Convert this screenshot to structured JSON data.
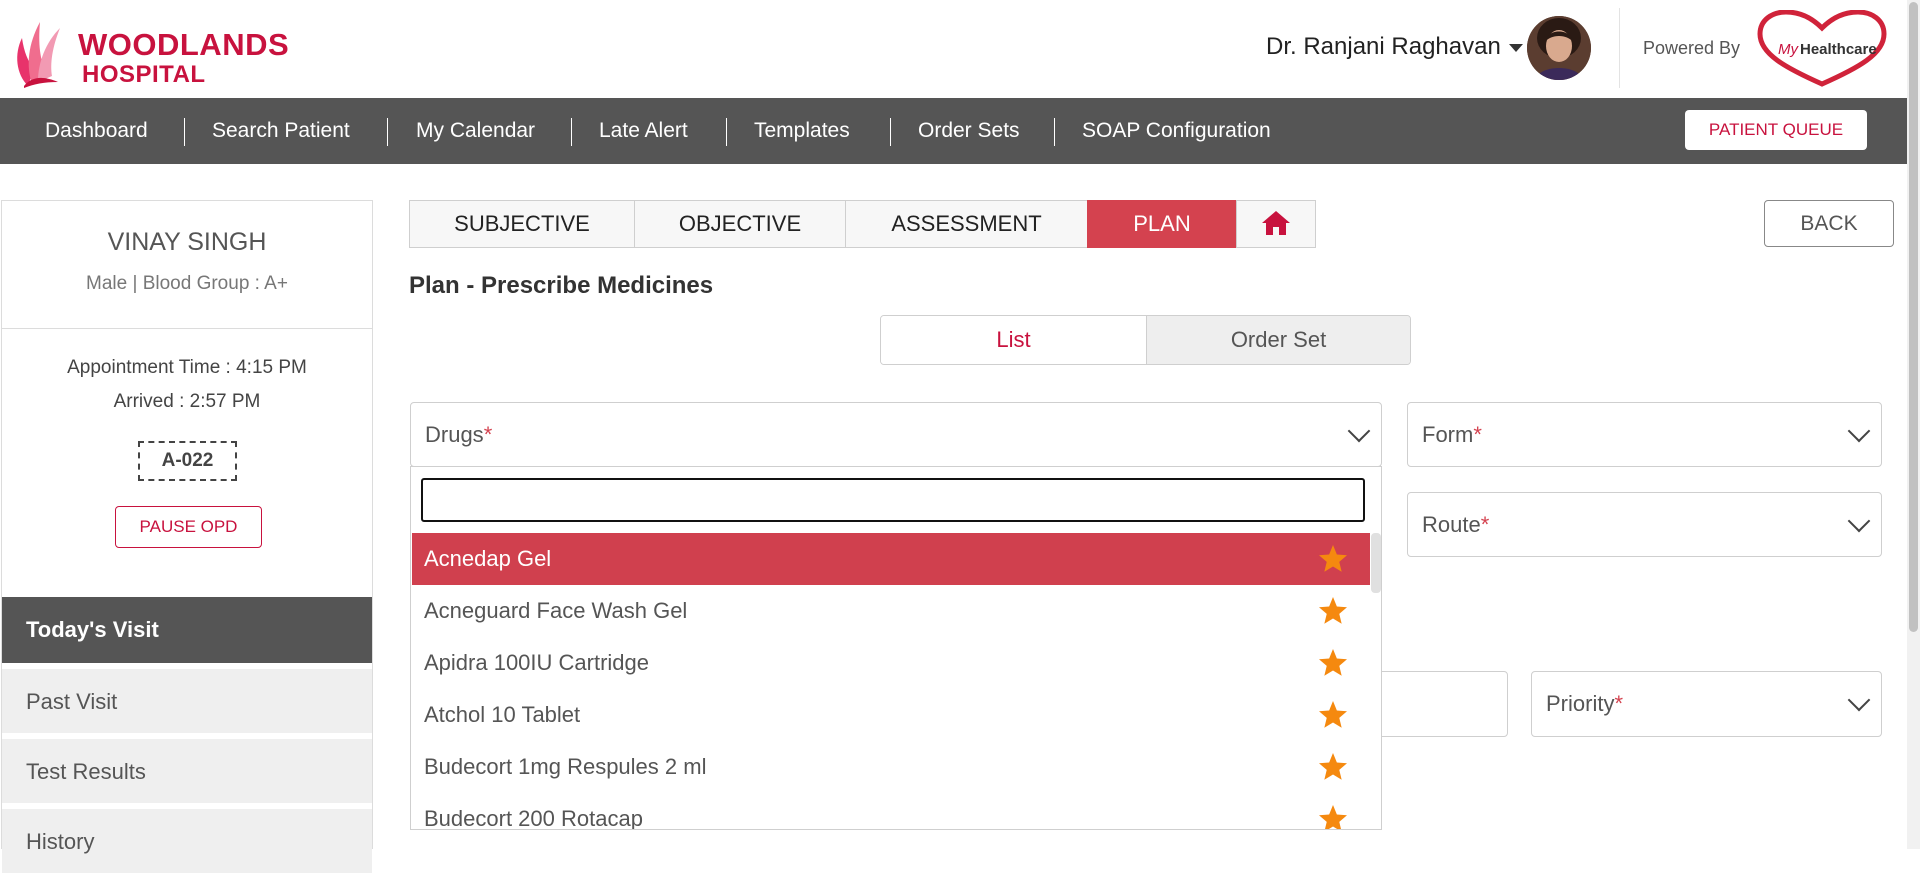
{
  "header": {
    "logo_line1": "WOODLANDS",
    "logo_line2": "HOSPITAL",
    "doctor_name": "Dr. Ranjani Raghavan",
    "powered_by": "Powered By",
    "partner_logo_text": "MyHealthcare"
  },
  "nav": {
    "items": [
      "Dashboard",
      "Search Patient",
      "My Calendar",
      "Late Alert",
      "Templates",
      "Order Sets",
      "SOAP Configuration"
    ],
    "patient_queue": "PATIENT QUEUE"
  },
  "patient": {
    "name": "VINAY SINGH",
    "info": "Male | Blood Group : A+",
    "appointment": "Appointment Time : 4:15 PM",
    "arrived": "Arrived : 2:57 PM",
    "token": "A-022",
    "pause_label": "PAUSE OPD"
  },
  "visit_menu": [
    "Today's Visit",
    "Past Visit",
    "Test Results",
    "History"
  ],
  "tabs": [
    "SUBJECTIVE",
    "OBJECTIVE",
    "ASSESSMENT",
    "PLAN"
  ],
  "active_tab": "PLAN",
  "back_label": "BACK",
  "section_title": "Plan - Prescribe Medicines",
  "toggle": {
    "list": "List",
    "order_set": "Order Set"
  },
  "fields": {
    "drugs": "Drugs",
    "form": "Form",
    "route": "Route",
    "priority": "Priority",
    "required_mark": "*"
  },
  "dropdown": {
    "search_value": "",
    "items": [
      "Acnedap Gel",
      "Acneguard Face Wash Gel",
      "Apidra 100IU Cartridge",
      "Atchol 10 Tablet",
      "Budecort 1mg Respules 2 ml",
      "Budecort 200 Rotacap"
    ],
    "selected_index": 0
  },
  "colors": {
    "brand": "#c8123e",
    "active_tab": "#d4424f",
    "nav_bg": "#555555",
    "star": "#f5890f"
  },
  "icons": {
    "home": "home-icon",
    "star": "star-icon",
    "chevron": "chevron-down-icon"
  }
}
